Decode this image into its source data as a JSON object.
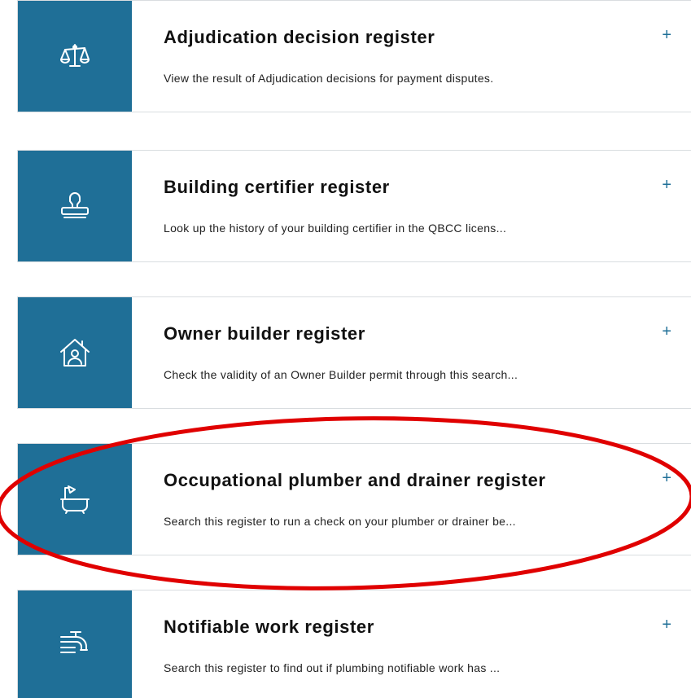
{
  "cards": [
    {
      "title": "Adjudication decision register",
      "description": "View the result of Adjudication decisions for payment disputes.",
      "expand": "+",
      "icon": "scales-icon"
    },
    {
      "title": "Building certifier register",
      "description": "Look up the history of your building certifier in the QBCC licens...",
      "expand": "+",
      "icon": "stamp-icon"
    },
    {
      "title": "Owner builder register",
      "description": "Check the validity of an Owner Builder permit through this search...",
      "expand": "+",
      "icon": "house-person-icon"
    },
    {
      "title": "Occupational plumber and drainer register",
      "description": "Search this register to run a check on your plumber or drainer be...",
      "expand": "+",
      "icon": "bathtub-icon"
    },
    {
      "title": "Notifiable work register",
      "description": "Search this register to find out if plumbing notifiable work has ...",
      "expand": "+",
      "icon": "tap-icon"
    }
  ],
  "colors": {
    "icon_background": "#1f6f97",
    "highlight": "#e00000"
  }
}
